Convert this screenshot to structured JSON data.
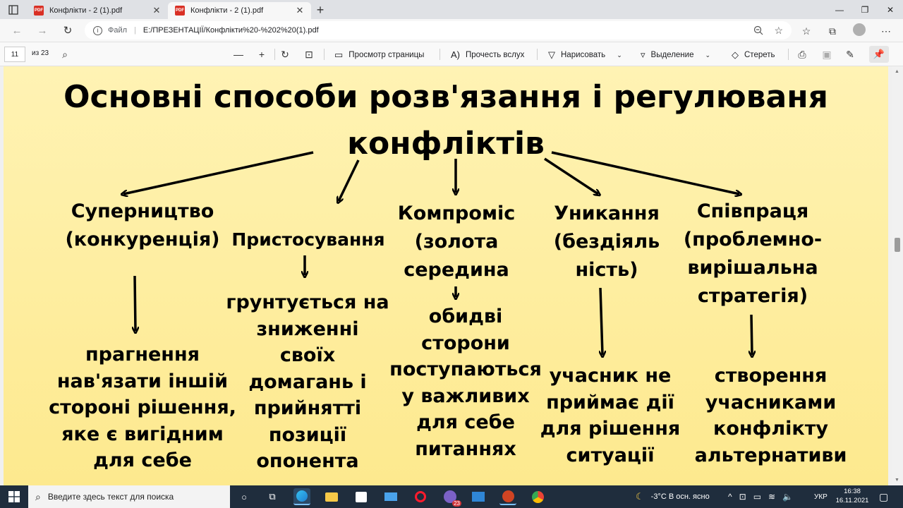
{
  "browser": {
    "tabs": [
      {
        "title": "Конфлікти - 2 (1).pdf",
        "active": false
      },
      {
        "title": "Конфлікти - 2 (1).pdf",
        "active": true
      }
    ],
    "address": {
      "label": "Файл",
      "url": "E:/ПРЕЗЕНТАЦІЇ/Конфлікти%20-%202%20(1).pdf"
    }
  },
  "pdf_toolbar": {
    "page_number": "11",
    "page_count": "из 23",
    "page_view": "Просмотр страницы",
    "read_aloud": "Прочесть вслух",
    "draw": "Нарисовать",
    "highlight": "Выделение",
    "erase": "Стереть"
  },
  "slide": {
    "title_line1": "Основні способи розв'язання і регулюваня",
    "title_line2": "конфліктів",
    "columns": [
      {
        "heading": [
          "Суперництво",
          "(конкуренція)"
        ],
        "description": [
          "прагнення",
          "нав'язати іншій",
          "стороні рішення,",
          "яке є вигідним",
          "для себе"
        ]
      },
      {
        "heading": [
          "Пристосування"
        ],
        "description": [
          "грунтується на",
          "зниженні",
          "своїх",
          "домагань і",
          "прийнятті",
          "позиції",
          "опонента"
        ]
      },
      {
        "heading": [
          "Компроміс",
          "(золота",
          "середина"
        ],
        "description": [
          "обидві",
          "сторони",
          "поступаються",
          "у важливих",
          "для себе",
          "питаннях"
        ]
      },
      {
        "heading": [
          "Уникання",
          "(бездіяль",
          "ність)"
        ],
        "description": [
          "учасник не",
          "приймає дії",
          "для рішення",
          "ситуації"
        ]
      },
      {
        "heading": [
          "Співпраця",
          "(проблемно-",
          "вирішальна",
          "стратегія)"
        ],
        "description": [
          "створення",
          "учасниками",
          "конфлікту",
          "альтернативи"
        ]
      }
    ],
    "background_color": "#fdeb97"
  },
  "taskbar": {
    "search_placeholder": "Введите здесь текст для поиска",
    "weather": "-3°C  В осн. ясно",
    "language": "УКР",
    "time": "16:38",
    "date": "16.11.2021",
    "teams_badge": "23"
  }
}
